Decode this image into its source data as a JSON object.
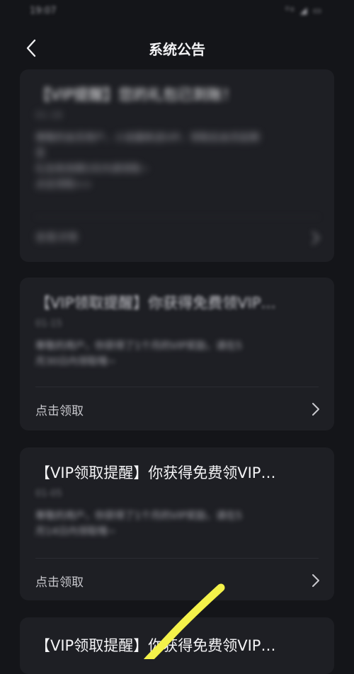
{
  "status_bar": {
    "time": "19:07",
    "signal": "⁰ᵍ ◢ ▭"
  },
  "nav": {
    "title": "系统公告"
  },
  "cards": [
    {
      "title": "【VIP提醒】您的礼包已到账！",
      "date": "01-18",
      "body_lines": [
        "尊敬的会员用户，小说最新送VIP，领取后会员延期",
        "至",
        "礼包有效期3天内请领取~",
        "点击领取>>"
      ],
      "action": "查看详情"
    },
    {
      "title": "【VIP领取提醒】你获得免费领VIP…",
      "date": "01-15",
      "body_lines": [
        "尊敬的用户，你获得了1个月的VIP奖励，请在5",
        "月30日内领取哦~"
      ],
      "action": "点击领取"
    },
    {
      "title": "【VIP领取提醒】你获得免费领VIP…",
      "date": "01-05",
      "body_lines": [
        "尊敬的用户，你获得了1个月的VIP奖励，请在5",
        "月14日内领取哦~"
      ],
      "action": "点击领取"
    },
    {
      "title": "【VIP领取提醒】你获得免费领VIP…"
    }
  ],
  "colors": {
    "background": "#141519",
    "card": "#1e1f24",
    "highlight_stroke": "#f4f24a"
  }
}
